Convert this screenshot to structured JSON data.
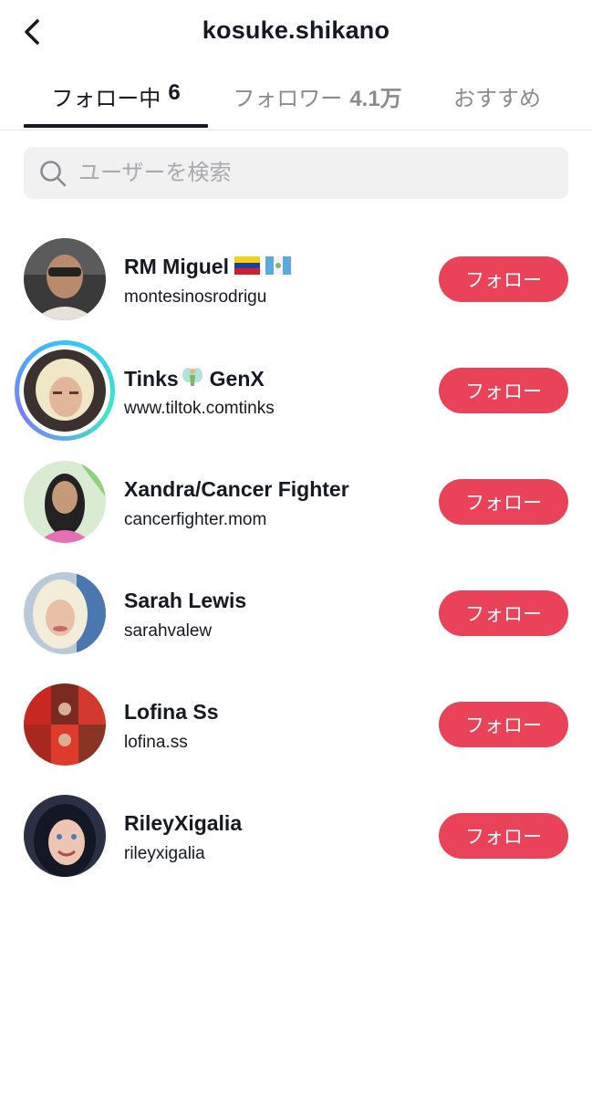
{
  "header": {
    "title": "kosuke.shikano"
  },
  "tabs": [
    {
      "label": "フォロー中",
      "count": "6"
    },
    {
      "label": "フォロワー",
      "count": "4.1万"
    },
    {
      "label": "おすすめ",
      "count": ""
    }
  ],
  "search": {
    "placeholder": "ユーザーを検索"
  },
  "users": [
    {
      "name": "RM Miguel",
      "handle": "montesinosrodrigu",
      "button": "フォロー"
    },
    {
      "name": "Tinks",
      "name_suffix": "GenX",
      "handle": "www.tiltok.comtinks",
      "button": "フォロー"
    },
    {
      "name": "Xandra/Cancer Fighter",
      "handle": "cancerfighter.mom",
      "button": "フォロー"
    },
    {
      "name": "Sarah Lewis",
      "handle": "sarahvalew",
      "button": "フォロー"
    },
    {
      "name": "Lofina Ss",
      "handle": "lofina.ss",
      "button": "フォロー"
    },
    {
      "name": "RileyXigalia",
      "handle": "rileyxigalia",
      "button": "フォロー"
    }
  ],
  "colors": {
    "accent": "#ea4359",
    "text": "#161823",
    "muted": "#8a8b91"
  }
}
